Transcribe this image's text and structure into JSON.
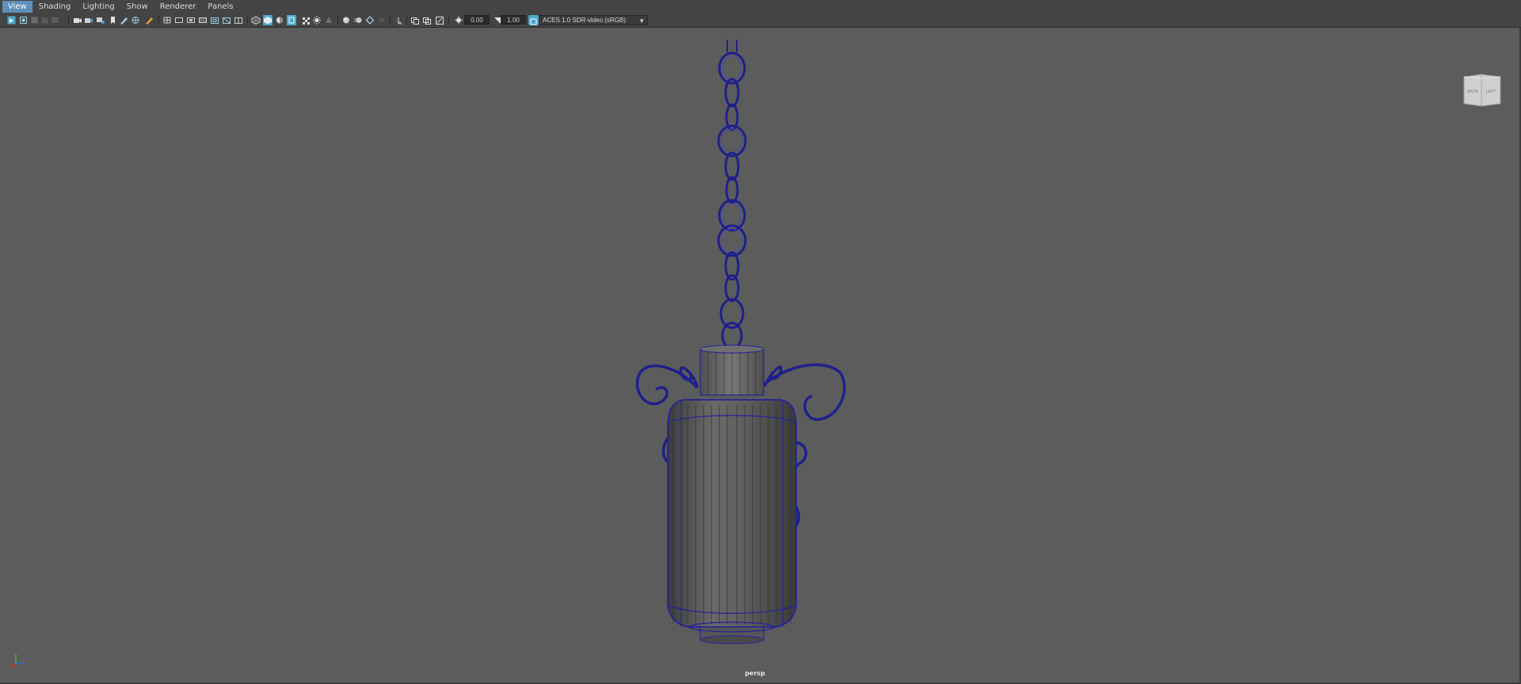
{
  "menu": {
    "items": [
      {
        "label": "View",
        "active": true
      },
      {
        "label": "Shading"
      },
      {
        "label": "Lighting"
      },
      {
        "label": "Show"
      },
      {
        "label": "Renderer"
      },
      {
        "label": "Panels"
      }
    ]
  },
  "toolbar": {
    "exposure_value": "0.00",
    "gamma_value": "1.00",
    "color_space": "ACES 1.0 SDR-video (sRGB)"
  },
  "viewport": {
    "camera_label": "persp",
    "viewcube": {
      "face_back": "BACK",
      "face_left": "LEFT"
    }
  },
  "colors": {
    "wireframe": "#2b2ba8",
    "viewport_bg": "#5c5c5c",
    "active_menu": "#5d8fb8"
  }
}
